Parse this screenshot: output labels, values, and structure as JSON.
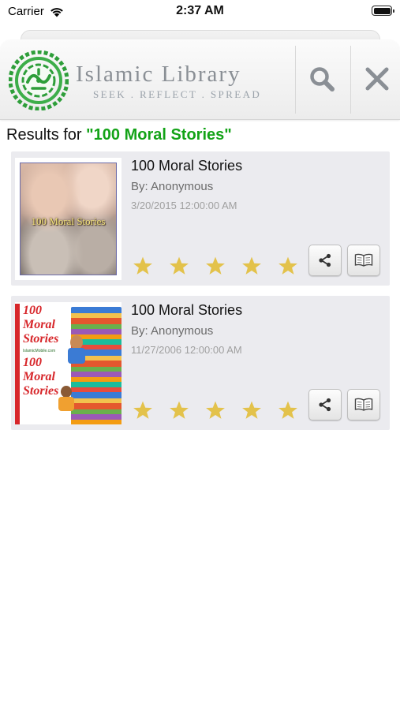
{
  "status_bar": {
    "carrier": "Carrier",
    "time": "2:37 AM"
  },
  "header": {
    "brand_title": "Islamic Library",
    "brand_tagline": "SEEK . REFLECT . SPREAD",
    "icons": {
      "search": "search-icon",
      "close": "close-icon"
    }
  },
  "results": {
    "label": "Results for",
    "query": "\"100 Moral Stories\"",
    "query_color": "#13a317",
    "items": [
      {
        "title": "100 Moral Stories",
        "author": "By: Anonymous",
        "date": "3/20/2015 12:00:00 AM",
        "cover_text": "100 Moral Stories",
        "rating": 5,
        "actions": [
          "share-icon",
          "open-book-icon"
        ]
      },
      {
        "title": "100 Moral Stories",
        "author": "By: Anonymous",
        "date": "11/27/2006 12:00:00 AM",
        "cover_lines": [
          "100",
          "Moral",
          "Stories",
          "IslamicMobile.com",
          "100",
          "Moral",
          "Stories"
        ],
        "rating": 5,
        "actions": [
          "share-icon",
          "open-book-icon"
        ]
      }
    ]
  },
  "colors": {
    "star": "#e3c24b",
    "card_bg": "#ebebef",
    "brand_green": "#2e9e3a"
  }
}
